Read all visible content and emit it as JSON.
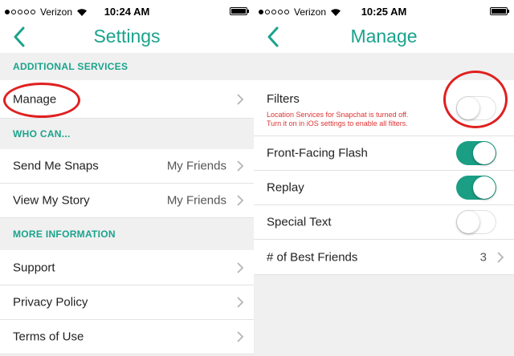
{
  "left": {
    "status": {
      "carrier": "Verizon",
      "time": "10:24 AM"
    },
    "title": "Settings",
    "sections": {
      "additional": "ADDITIONAL SERVICES",
      "who_can": "WHO CAN...",
      "more_info": "MORE INFORMATION"
    },
    "rows": {
      "manage": "Manage",
      "send_snaps": {
        "label": "Send Me Snaps",
        "value": "My Friends"
      },
      "view_story": {
        "label": "View My Story",
        "value": "My Friends"
      },
      "support": "Support",
      "privacy": "Privacy Policy",
      "terms": "Terms of Use"
    }
  },
  "right": {
    "status": {
      "carrier": "Verizon",
      "time": "10:25 AM"
    },
    "title": "Manage",
    "filters": {
      "label": "Filters",
      "warning_line1": "Location Services for Snapchat is turned off.",
      "warning_line2": "Turn it on in iOS settings to enable all filters.",
      "enabled": false
    },
    "front_flash": {
      "label": "Front-Facing Flash",
      "enabled": true
    },
    "replay": {
      "label": "Replay",
      "enabled": true
    },
    "special_text": {
      "label": "Special Text",
      "enabled": false
    },
    "best_friends": {
      "label": "# of Best Friends",
      "value": "3"
    }
  },
  "colors": {
    "accent": "#1aa38c",
    "toggle_on": "#1a9e84",
    "highlight_circle": "#e02020",
    "warning": "#dd3333"
  },
  "icons": [
    "back-chevron-icon",
    "chevron-right-icon",
    "wifi-icon",
    "battery-icon",
    "signal-dots-icon"
  ]
}
